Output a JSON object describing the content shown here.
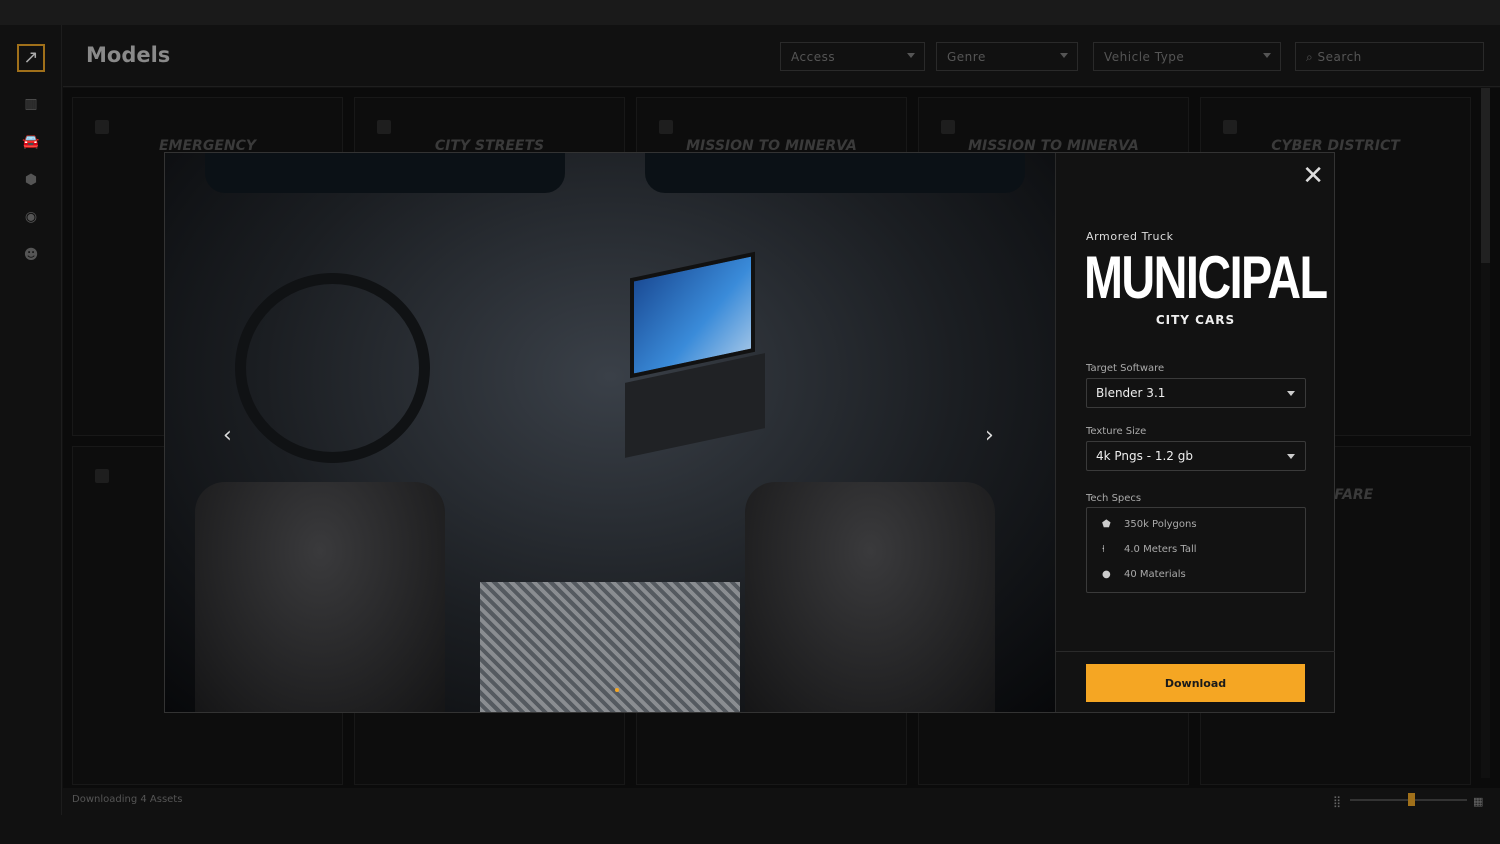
{
  "header": {
    "title": "Models",
    "filters": [
      {
        "label": "Access"
      },
      {
        "label": "Genre"
      },
      {
        "label": "Vehicle Type"
      }
    ],
    "search_placeholder": "Search"
  },
  "sidebar": {
    "items": [
      {
        "icon": "library-icon"
      },
      {
        "icon": "car-icon",
        "active": true
      },
      {
        "icon": "cube-icon"
      },
      {
        "icon": "disc-icon"
      },
      {
        "icon": "user-icon"
      }
    ]
  },
  "cards": [
    {
      "title": "EMERGENCY"
    },
    {
      "title": "CITY STREETS"
    },
    {
      "title": "MISSION TO MINERVA"
    },
    {
      "title": "MISSION TO MINERVA"
    },
    {
      "title": "CYBER DISTRICT"
    },
    {
      "title": ""
    },
    {
      "title": ""
    },
    {
      "title": ""
    },
    {
      "title": ""
    },
    {
      "title": "WARFARE"
    }
  ],
  "modal": {
    "subtitle": "Armored Truck",
    "name": "MUNICIPAL",
    "collection": "CITY CARS",
    "target_software_label": "Target Software",
    "target_software": "Blender 3.1",
    "texture_label": "Texture Size",
    "texture": "4k Pngs - 1.2 gb",
    "specs_label": "Tech Specs",
    "specs": [
      {
        "icon": "polygon-icon",
        "glyph": "⬟",
        "text": "350k Polygons"
      },
      {
        "icon": "height-icon",
        "glyph": "⍿",
        "text": "4.0 Meters Tall"
      },
      {
        "icon": "material-icon",
        "glyph": "●",
        "text": "40 Materials"
      }
    ],
    "download_label": "Download",
    "close_glyph": "✕",
    "prev_glyph": "‹",
    "next_glyph": "›"
  },
  "footer": {
    "status": "Downloading 4 Assets",
    "zoom_level_percent": 52
  },
  "colors": {
    "accent": "#f5a623"
  }
}
